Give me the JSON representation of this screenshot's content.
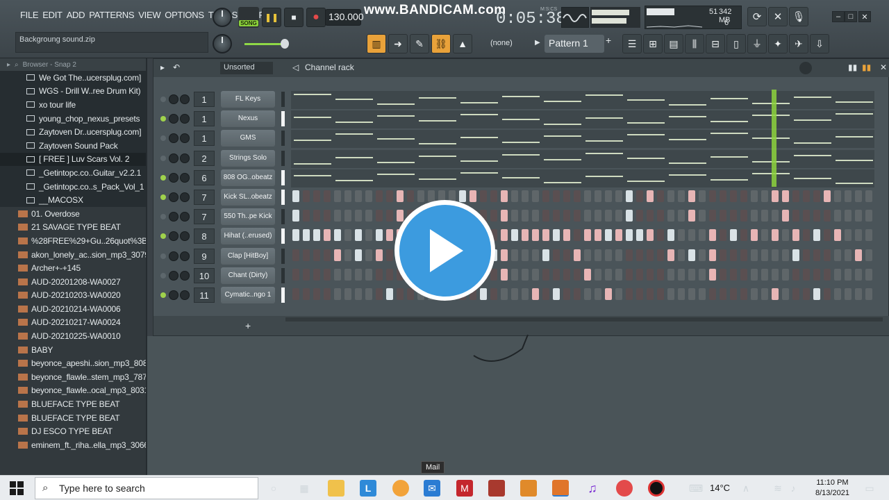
{
  "menu": [
    "FILE",
    "EDIT",
    "ADD",
    "PATTERNS",
    "VIEW",
    "OPTIONS",
    "TOOLS",
    "HELP"
  ],
  "hint_text": "Backgroung sound.zip",
  "transport": {
    "song_label": "SONG",
    "tempo": "130.000"
  },
  "watermark": "www.BANDICAM.com",
  "time_display": "0:05:38",
  "time_unit": "M:S:CS",
  "cpu": {
    "value": "51",
    "memory": "342 MB",
    "polyphony": "6"
  },
  "pattern": {
    "none_label": "(none)",
    "current": "Pattern 1"
  },
  "browser": {
    "title": "Browser - Snap 2",
    "folders": [
      "We Got The..ucersplug.com]",
      "WGS - Drill W..ree Drum Kit)",
      "xo tour life",
      "young_chop_nexus_presets",
      "Zaytoven Dr..ucersplug.com]",
      "Zaytoven Sound Pack",
      "[ FREE ] Luv Scars Vol. 2",
      "_Getintopc.co..Guitar_v2.2.1",
      "_Getintopc.co..s_Pack_Vol_1",
      "__MACOSX"
    ],
    "files": [
      "01. Overdose",
      "21 SAVAGE TYPE BEAT",
      "%28FREE%29+Gu..26quot%3B+Typ",
      "akon_lonely_ac..sion_mp3_30799",
      "Archer+-+145",
      "AUD-20201208-WA0027",
      "AUD-20210203-WA0020",
      "AUD-20210214-WA0006",
      "AUD-20210217-WA0024",
      "AUD-20210225-WA0010",
      "BABY",
      "beyonce_apeshi..sion_mp3_80870",
      "beyonce_flawle..stem_mp3_78773",
      "beyonce_flawle..ocal_mp3_80316",
      "BLUEFACE TYPE BEAT",
      "BLUEFACE TYPE BEAT",
      "DJ ESCO TYPE BEAT",
      "eminem_ft._riha..ella_mp3_30662"
    ]
  },
  "rack": {
    "title": "Channel rack",
    "filter": "Unsorted",
    "channels": [
      {
        "num": "1",
        "name": "FL Keys",
        "kind": "roll",
        "active": false
      },
      {
        "num": "1",
        "name": "Nexus",
        "kind": "roll",
        "active": true
      },
      {
        "num": "1",
        "name": "GMS",
        "kind": "roll",
        "active": false
      },
      {
        "num": "2",
        "name": "Strings Solo",
        "kind": "roll",
        "active": false
      },
      {
        "num": "6",
        "name": "808 OG..obeatz",
        "kind": "roll",
        "active": true
      },
      {
        "num": "7",
        "name": "Kick SL..obeatz",
        "kind": "steps",
        "active": true
      },
      {
        "num": "7",
        "name": "550 Th..pe Kick",
        "kind": "steps",
        "active": false
      },
      {
        "num": "8",
        "name": "Hihat (..erused)",
        "kind": "steps",
        "active": true
      },
      {
        "num": "9",
        "name": "Clap [HitBoy]",
        "kind": "steps",
        "active": false
      },
      {
        "num": "10",
        "name": "Chant (Dirty)",
        "kind": "steps",
        "active": false
      },
      {
        "num": "11",
        "name": "Cymatic..ngo 1",
        "kind": "steps",
        "active": true
      }
    ],
    "add_label": "+"
  },
  "tooltip": "Mail",
  "taskbar": {
    "search_placeholder": "Type here to search",
    "weather": "14°C",
    "time": "11:10 PM",
    "date": "8/13/2021"
  },
  "colors": {
    "accent_green": "#8dd43d",
    "accent_orange": "#e9a23a",
    "play_blue": "#3c9bdf"
  }
}
